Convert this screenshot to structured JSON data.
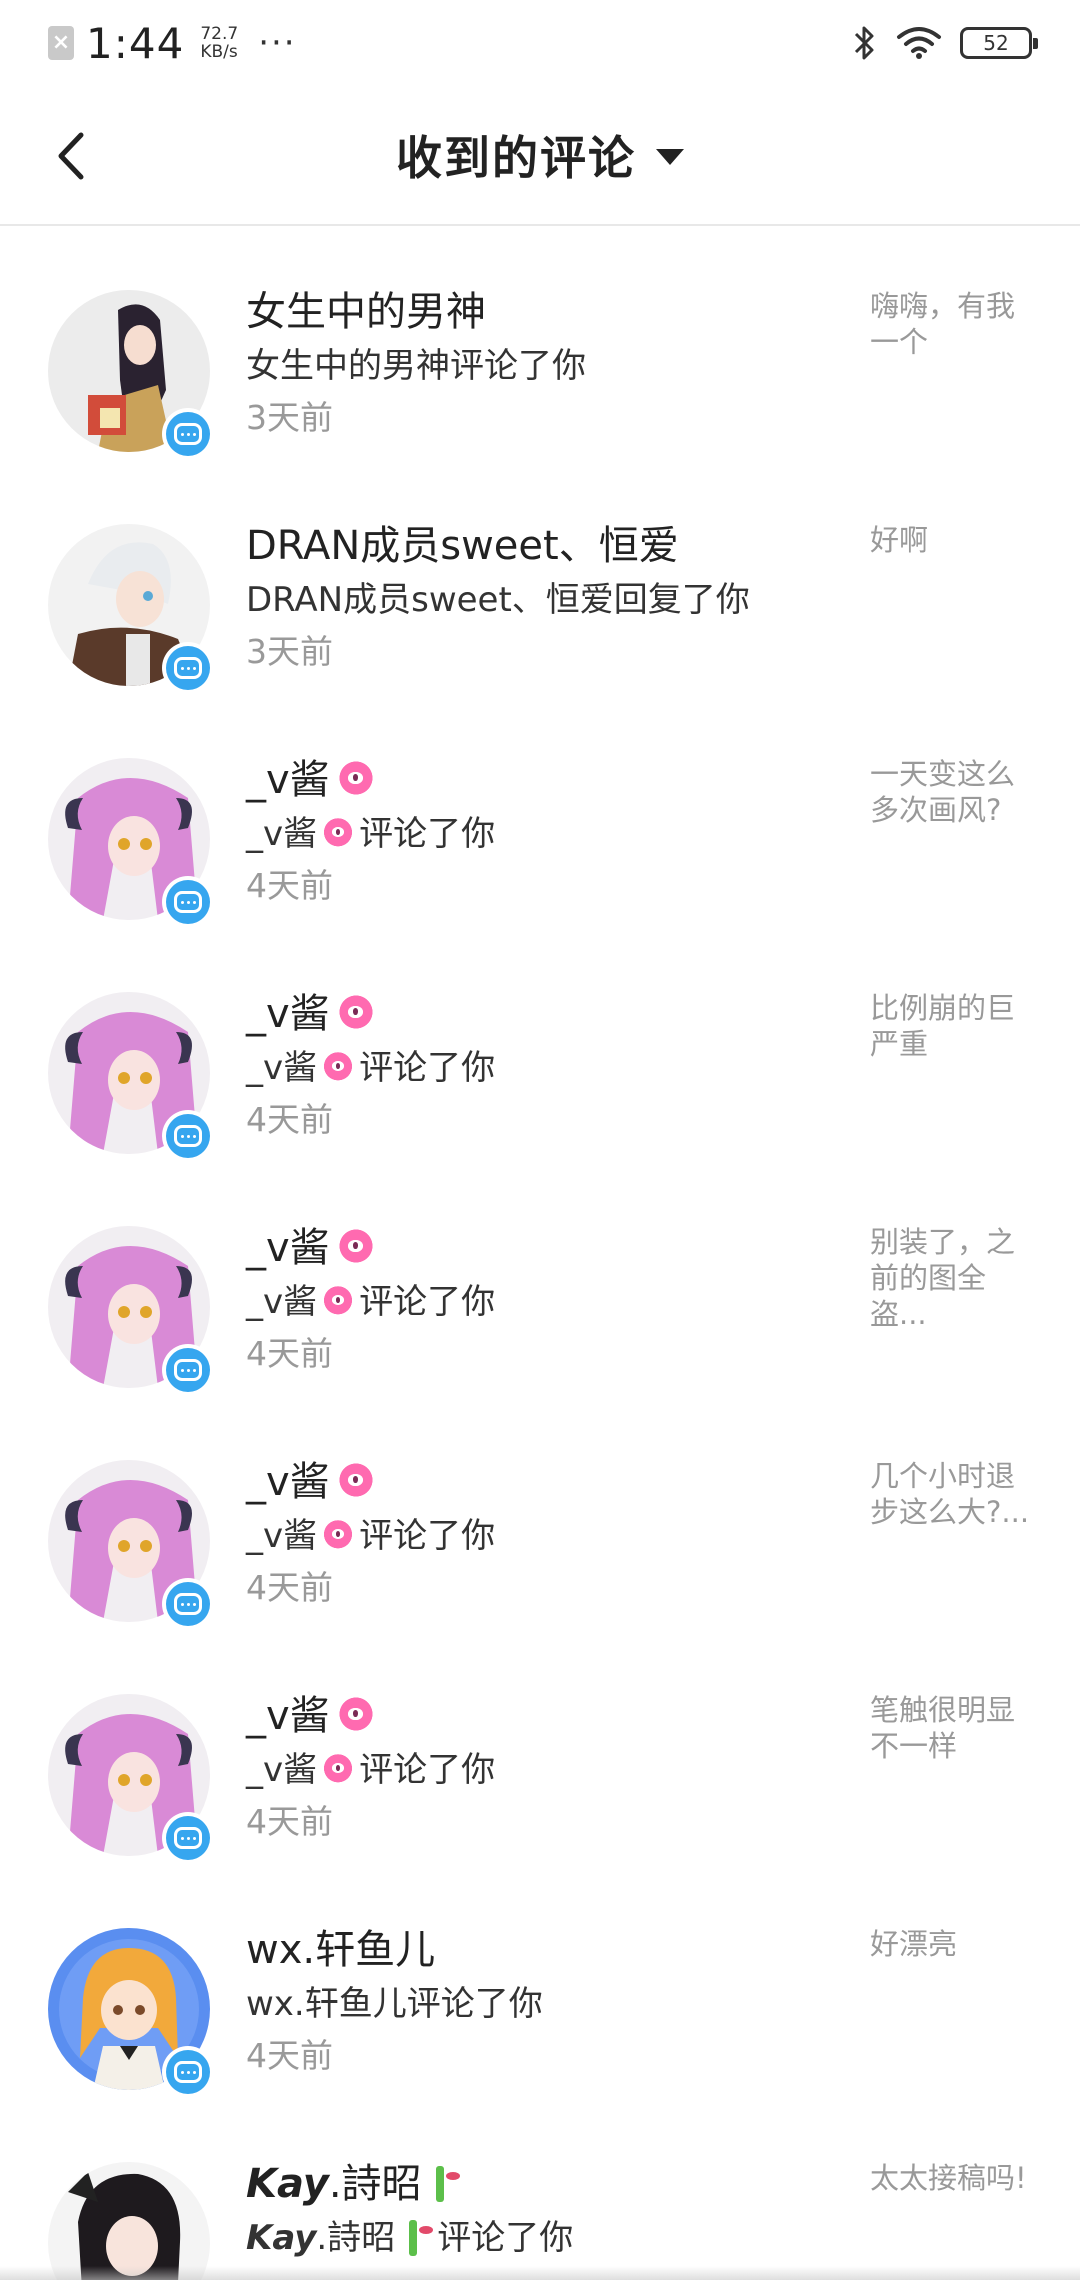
{
  "status_bar": {
    "time": "1:44",
    "speed_value": "72.7",
    "speed_unit": "KB/s",
    "dots": "···",
    "battery": "52"
  },
  "header": {
    "title": "收到的评论"
  },
  "comments": [
    {
      "name": "女生中的男神",
      "action": "女生中的男神评论了你",
      "time": "3天前",
      "snippet": "嗨嗨，有我一个",
      "avatar": "girl-dark-hair"
    },
    {
      "name": "DRAN成员sweet、恒爱",
      "action": "DRAN成员sweet、恒爱回复了你",
      "time": "3天前",
      "snippet": "好啊",
      "avatar": "white-hair-boy"
    },
    {
      "name": "_v酱",
      "action_suffix": "评论了你",
      "time": "4天前",
      "snippet": "一天变这么多次画风?",
      "avatar": "pink-hair-girl"
    },
    {
      "name": "_v酱",
      "action_suffix": "评论了你",
      "time": "4天前",
      "snippet": "比例崩的巨严重",
      "avatar": "pink-hair-girl"
    },
    {
      "name": "_v酱",
      "action_suffix": "评论了你",
      "time": "4天前",
      "snippet": "别装了，之前的图全盗...",
      "avatar": "pink-hair-girl"
    },
    {
      "name": "_v酱",
      "action_suffix": "评论了你",
      "time": "4天前",
      "snippet": "几个小时退步这么大?...",
      "avatar": "pink-hair-girl"
    },
    {
      "name": "_v酱",
      "action_suffix": "评论了你",
      "time": "4天前",
      "snippet": "笔触很明显不一样",
      "avatar": "pink-hair-girl"
    },
    {
      "name": "wx.轩鱼儿",
      "action": "wx.轩鱼儿评论了你",
      "time": "4天前",
      "snippet": "好漂亮",
      "avatar": "blonde-girl-blue-bg"
    },
    {
      "name_styled": "Kay",
      "name_rest": ".詩昭",
      "action_suffix": "评论了你",
      "time": "",
      "snippet": "太太接稿吗!",
      "avatar": "dark-hair-girl"
    }
  ],
  "colors": {
    "badge": "#36a6ef",
    "secondary_text": "#999999",
    "octopus_emoji": "#ff6ab0"
  }
}
